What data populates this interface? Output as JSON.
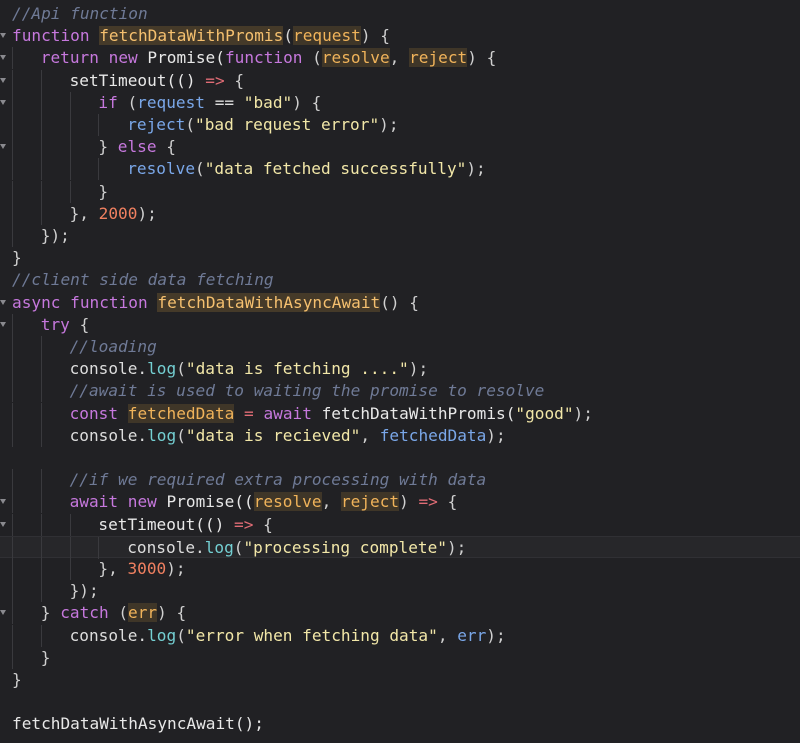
{
  "editor": {
    "highlighted_line": 24,
    "lines": [
      {
        "fold": false,
        "indent": 0,
        "tokens": [
          {
            "t": "//Api function",
            "c": "comment"
          }
        ]
      },
      {
        "fold": true,
        "indent": 0,
        "tokens": [
          {
            "t": "function",
            "c": "kw"
          },
          {
            "t": " ",
            "c": "txt"
          },
          {
            "t": "fetchDataWithPromis",
            "c": "fndef"
          },
          {
            "t": "(",
            "c": "paren"
          },
          {
            "t": "request",
            "c": "paramhl"
          },
          {
            "t": ") {",
            "c": "punct"
          }
        ]
      },
      {
        "fold": true,
        "indent": 1,
        "tokens": [
          {
            "t": "return",
            "c": "kw"
          },
          {
            "t": " ",
            "c": "txt"
          },
          {
            "t": "new",
            "c": "kw"
          },
          {
            "t": " Promise(",
            "c": "fn"
          },
          {
            "t": "function",
            "c": "kw"
          },
          {
            "t": " (",
            "c": "punct"
          },
          {
            "t": "resolve",
            "c": "paramhl"
          },
          {
            "t": ", ",
            "c": "punct"
          },
          {
            "t": "reject",
            "c": "paramhl"
          },
          {
            "t": ") {",
            "c": "punct"
          }
        ]
      },
      {
        "fold": true,
        "indent": 2,
        "tokens": [
          {
            "t": "setTimeout(() ",
            "c": "fn"
          },
          {
            "t": "=>",
            "c": "op"
          },
          {
            "t": " {",
            "c": "punct"
          }
        ]
      },
      {
        "fold": true,
        "indent": 3,
        "tokens": [
          {
            "t": "if",
            "c": "kw"
          },
          {
            "t": " (",
            "c": "punct"
          },
          {
            "t": "request",
            "c": "var"
          },
          {
            "t": " == ",
            "c": "txt"
          },
          {
            "t": "\"bad\"",
            "c": "str"
          },
          {
            "t": ") {",
            "c": "punct"
          }
        ]
      },
      {
        "fold": false,
        "indent": 4,
        "tokens": [
          {
            "t": "reject",
            "c": "var"
          },
          {
            "t": "(",
            "c": "punct"
          },
          {
            "t": "\"bad request error\"",
            "c": "str"
          },
          {
            "t": ");",
            "c": "punct"
          }
        ]
      },
      {
        "fold": true,
        "indent": 3,
        "tokens": [
          {
            "t": "} ",
            "c": "punct"
          },
          {
            "t": "else",
            "c": "kw"
          },
          {
            "t": " {",
            "c": "punct"
          }
        ]
      },
      {
        "fold": false,
        "indent": 4,
        "tokens": [
          {
            "t": "resolve",
            "c": "var"
          },
          {
            "t": "(",
            "c": "punct"
          },
          {
            "t": "\"data fetched successfully\"",
            "c": "str"
          },
          {
            "t": ");",
            "c": "punct"
          }
        ]
      },
      {
        "fold": false,
        "indent": 3,
        "tokens": [
          {
            "t": "}",
            "c": "punct"
          }
        ]
      },
      {
        "fold": false,
        "indent": 2,
        "tokens": [
          {
            "t": "}, ",
            "c": "punct"
          },
          {
            "t": "2000",
            "c": "num"
          },
          {
            "t": ");",
            "c": "punct"
          }
        ]
      },
      {
        "fold": false,
        "indent": 1,
        "tokens": [
          {
            "t": "});",
            "c": "punct"
          }
        ]
      },
      {
        "fold": false,
        "indent": 0,
        "tokens": [
          {
            "t": "}",
            "c": "punct"
          }
        ]
      },
      {
        "fold": false,
        "indent": 0,
        "tokens": [
          {
            "t": "//client side data fetching",
            "c": "comment"
          }
        ]
      },
      {
        "fold": true,
        "indent": 0,
        "tokens": [
          {
            "t": "async",
            "c": "kw"
          },
          {
            "t": " ",
            "c": "txt"
          },
          {
            "t": "function",
            "c": "kw"
          },
          {
            "t": " ",
            "c": "txt"
          },
          {
            "t": "fetchDataWithAsyncAwait",
            "c": "fndef"
          },
          {
            "t": "() {",
            "c": "punct"
          }
        ]
      },
      {
        "fold": true,
        "indent": 1,
        "tokens": [
          {
            "t": "try",
            "c": "kw"
          },
          {
            "t": " {",
            "c": "punct"
          }
        ]
      },
      {
        "fold": false,
        "indent": 2,
        "tokens": [
          {
            "t": "//loading",
            "c": "comment"
          }
        ]
      },
      {
        "fold": false,
        "indent": 2,
        "tokens": [
          {
            "t": "console.",
            "c": "txt"
          },
          {
            "t": "log",
            "c": "method"
          },
          {
            "t": "(",
            "c": "punct"
          },
          {
            "t": "\"data is fetching ....\"",
            "c": "str"
          },
          {
            "t": ");",
            "c": "punct"
          }
        ]
      },
      {
        "fold": false,
        "indent": 2,
        "tokens": [
          {
            "t": "//await is used to waiting the promise to resolve",
            "c": "comment"
          }
        ]
      },
      {
        "fold": false,
        "indent": 2,
        "tokens": [
          {
            "t": "const",
            "c": "kw"
          },
          {
            "t": " ",
            "c": "txt"
          },
          {
            "t": "fetchedData",
            "c": "paramhl"
          },
          {
            "t": " ",
            "c": "txt"
          },
          {
            "t": "=",
            "c": "op"
          },
          {
            "t": " ",
            "c": "txt"
          },
          {
            "t": "await",
            "c": "kw"
          },
          {
            "t": " fetchDataWithPromis(",
            "c": "fn"
          },
          {
            "t": "\"good\"",
            "c": "str"
          },
          {
            "t": ");",
            "c": "punct"
          }
        ]
      },
      {
        "fold": false,
        "indent": 2,
        "tokens": [
          {
            "t": "console.",
            "c": "txt"
          },
          {
            "t": "log",
            "c": "method"
          },
          {
            "t": "(",
            "c": "punct"
          },
          {
            "t": "\"data is recieved\"",
            "c": "str"
          },
          {
            "t": ", ",
            "c": "punct"
          },
          {
            "t": "fetchedData",
            "c": "var"
          },
          {
            "t": ");",
            "c": "punct"
          }
        ]
      },
      {
        "fold": false,
        "indent": 0,
        "tokens": []
      },
      {
        "fold": false,
        "indent": 2,
        "tokens": [
          {
            "t": "//if we required extra processing with data",
            "c": "comment"
          }
        ]
      },
      {
        "fold": true,
        "indent": 2,
        "tokens": [
          {
            "t": "await",
            "c": "kw"
          },
          {
            "t": " ",
            "c": "txt"
          },
          {
            "t": "new",
            "c": "kw"
          },
          {
            "t": " Promise((",
            "c": "fn"
          },
          {
            "t": "resolve",
            "c": "paramhl"
          },
          {
            "t": ", ",
            "c": "punct"
          },
          {
            "t": "reject",
            "c": "paramhl"
          },
          {
            "t": ") ",
            "c": "punct"
          },
          {
            "t": "=>",
            "c": "op"
          },
          {
            "t": " {",
            "c": "punct"
          }
        ]
      },
      {
        "fold": true,
        "indent": 3,
        "tokens": [
          {
            "t": "setTimeout(() ",
            "c": "fn"
          },
          {
            "t": "=>",
            "c": "op"
          },
          {
            "t": " {",
            "c": "punct"
          }
        ]
      },
      {
        "fold": false,
        "indent": 4,
        "tokens": [
          {
            "t": "console.",
            "c": "txt"
          },
          {
            "t": "log",
            "c": "method"
          },
          {
            "t": "(",
            "c": "punct"
          },
          {
            "t": "\"processing complete\"",
            "c": "str"
          },
          {
            "t": ");",
            "c": "punct"
          }
        ]
      },
      {
        "fold": false,
        "indent": 3,
        "tokens": [
          {
            "t": "}, ",
            "c": "punct"
          },
          {
            "t": "3000",
            "c": "num"
          },
          {
            "t": ");",
            "c": "punct"
          }
        ]
      },
      {
        "fold": false,
        "indent": 2,
        "tokens": [
          {
            "t": "});",
            "c": "punct"
          }
        ]
      },
      {
        "fold": true,
        "indent": 1,
        "tokens": [
          {
            "t": "} ",
            "c": "punct"
          },
          {
            "t": "catch",
            "c": "kw"
          },
          {
            "t": " (",
            "c": "punct"
          },
          {
            "t": "err",
            "c": "paramhl"
          },
          {
            "t": ") {",
            "c": "punct"
          }
        ]
      },
      {
        "fold": false,
        "indent": 2,
        "tokens": [
          {
            "t": "console.",
            "c": "txt"
          },
          {
            "t": "log",
            "c": "method"
          },
          {
            "t": "(",
            "c": "punct"
          },
          {
            "t": "\"error when fetching data\"",
            "c": "str"
          },
          {
            "t": ", ",
            "c": "punct"
          },
          {
            "t": "err",
            "c": "var"
          },
          {
            "t": ");",
            "c": "punct"
          }
        ]
      },
      {
        "fold": false,
        "indent": 1,
        "tokens": [
          {
            "t": "}",
            "c": "punct"
          }
        ]
      },
      {
        "fold": false,
        "indent": 0,
        "tokens": [
          {
            "t": "}",
            "c": "punct"
          }
        ]
      },
      {
        "fold": false,
        "indent": 0,
        "tokens": []
      },
      {
        "fold": false,
        "indent": 0,
        "tokens": [
          {
            "t": "fetchDataWithAsyncAwait();",
            "c": "fn"
          }
        ]
      }
    ]
  }
}
